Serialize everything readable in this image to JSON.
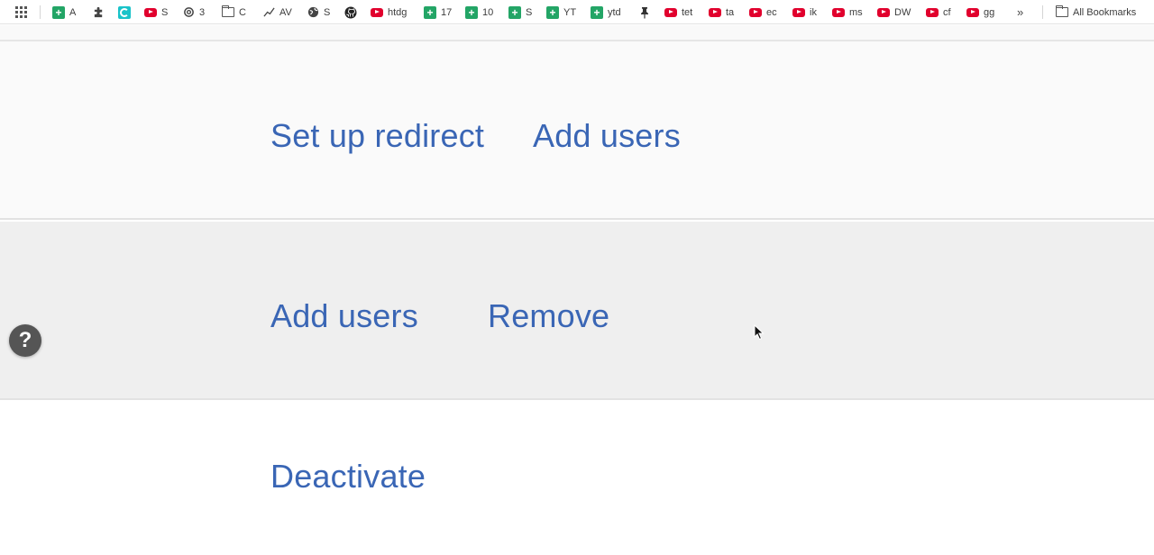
{
  "bookmarks_bar": {
    "items": [
      {
        "icon": "sheets-icon",
        "label": "A"
      },
      {
        "icon": "puzzle-icon",
        "label": ""
      },
      {
        "icon": "teal-app-icon",
        "label": ""
      },
      {
        "icon": "youtube-icon",
        "label": "S"
      },
      {
        "icon": "openai-icon",
        "label": "3"
      },
      {
        "icon": "folder-icon",
        "label": "C"
      },
      {
        "icon": "trend-icon",
        "label": "AV"
      },
      {
        "icon": "globe-icon",
        "label": "S"
      },
      {
        "icon": "github-icon",
        "label": ""
      },
      {
        "icon": "youtube-icon",
        "label": "htdg"
      },
      {
        "icon": "sheets-icon",
        "label": "17"
      },
      {
        "icon": "sheets-icon",
        "label": "10"
      },
      {
        "icon": "sheets-icon",
        "label": "S"
      },
      {
        "icon": "sheets-icon",
        "label": "YT"
      },
      {
        "icon": "sheets-icon",
        "label": "ytd"
      },
      {
        "icon": "pin-icon",
        "label": ""
      },
      {
        "icon": "youtube-icon",
        "label": "tet"
      },
      {
        "icon": "youtube-icon",
        "label": "ta"
      },
      {
        "icon": "youtube-icon",
        "label": "ec"
      },
      {
        "icon": "youtube-icon",
        "label": "ik"
      },
      {
        "icon": "youtube-icon",
        "label": "ms"
      },
      {
        "icon": "youtube-icon",
        "label": "DW"
      },
      {
        "icon": "youtube-icon",
        "label": "cf"
      },
      {
        "icon": "youtube-icon",
        "label": "gg"
      }
    ],
    "more_icon": "chevron-double-right-icon",
    "all_bookmarks_label": "All Bookmarks"
  },
  "sections": {
    "row1": {
      "set_up_redirect": "Set up redirect",
      "add_users": "Add users"
    },
    "row2": {
      "add_users": "Add users",
      "remove": "Remove"
    },
    "row3": {
      "deactivate": "Deactivate"
    }
  },
  "help_button": {
    "label": "?"
  },
  "colors": {
    "link": "#3a66b5",
    "help_bg": "#555555",
    "youtube": "#e1002d",
    "sheets": "#23a566"
  }
}
